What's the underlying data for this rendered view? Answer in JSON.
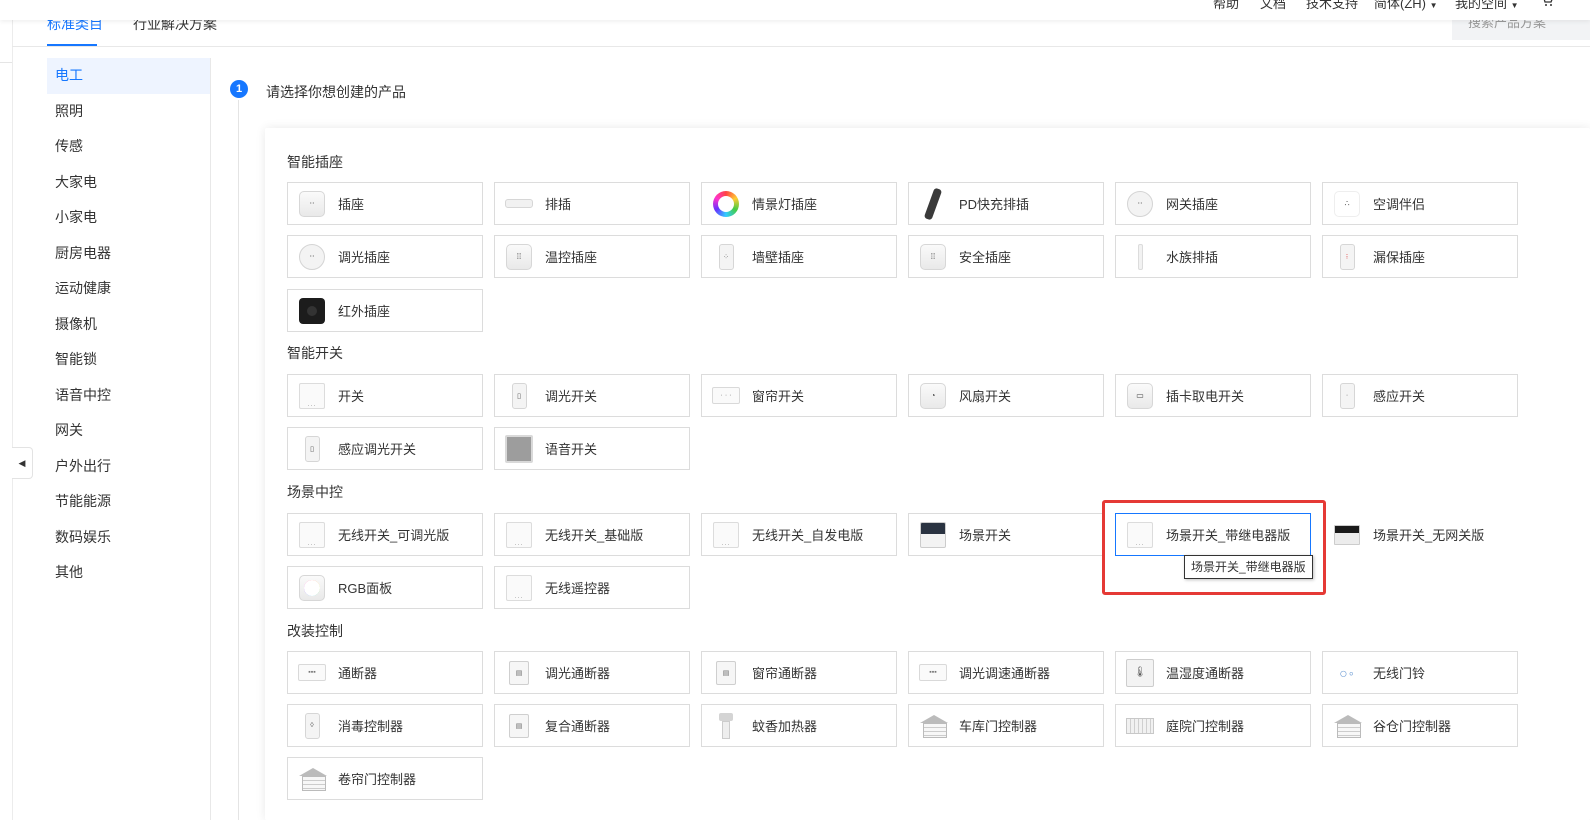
{
  "header": {
    "nav": [
      "帮助",
      "文档",
      "技术支持",
      "简体(ZH)",
      "我的空间"
    ],
    "search_placeholder": "搜索产品方案",
    "cart_icon": "cart-icon"
  },
  "tabs": [
    "标准类目",
    "行业解决方案"
  ],
  "sidebar": {
    "items": [
      "电工",
      "照明",
      "传感",
      "大家电",
      "小家电",
      "厨房电器",
      "运动健康",
      "摄像机",
      "智能锁",
      "语音中控",
      "网关",
      "户外出行",
      "节能能源",
      "数码娱乐",
      "其他"
    ],
    "collapse_glyph": "◀"
  },
  "step": {
    "number": "1",
    "title": "请选择你想创建的产品"
  },
  "sections": {
    "smart_socket": {
      "title": "智能插座",
      "items": [
        "插座",
        "排插",
        "情景灯插座",
        "PD快充排插",
        "网关插座",
        "空调伴侣",
        "调光插座",
        "温控插座",
        "墙壁插座",
        "安全插座",
        "水族排插",
        "漏保插座",
        "红外插座"
      ]
    },
    "smart_switch": {
      "title": "智能开关",
      "items": [
        "开关",
        "调光开关",
        "窗帘开关",
        "风扇开关",
        "插卡取电开关",
        "感应开关",
        "感应调光开关",
        "语音开关"
      ]
    },
    "scene_control": {
      "title": "场景中控",
      "items": [
        "无线开关_可调光版",
        "无线开关_基础版",
        "无线开关_自发电版",
        "场景开关",
        "场景开关_带继电器版",
        "场景开关_无网关版",
        "RGB面板",
        "无线遥控器"
      ]
    },
    "retrofit_control": {
      "title": "改装控制",
      "items": [
        "通断器",
        "调光通断器",
        "窗帘通断器",
        "调光调速通断器",
        "温湿度通断器",
        "无线门铃",
        "消毒控制器",
        "复合通断器",
        "蚊香加热器",
        "车库门控制器",
        "庭院门控制器",
        "谷仓门控制器",
        "卷帘门控制器"
      ]
    }
  },
  "tooltip": {
    "text": "场景开关_带继电器版"
  },
  "colors": {
    "accent": "#1677ff",
    "highlight": "#e53935"
  }
}
